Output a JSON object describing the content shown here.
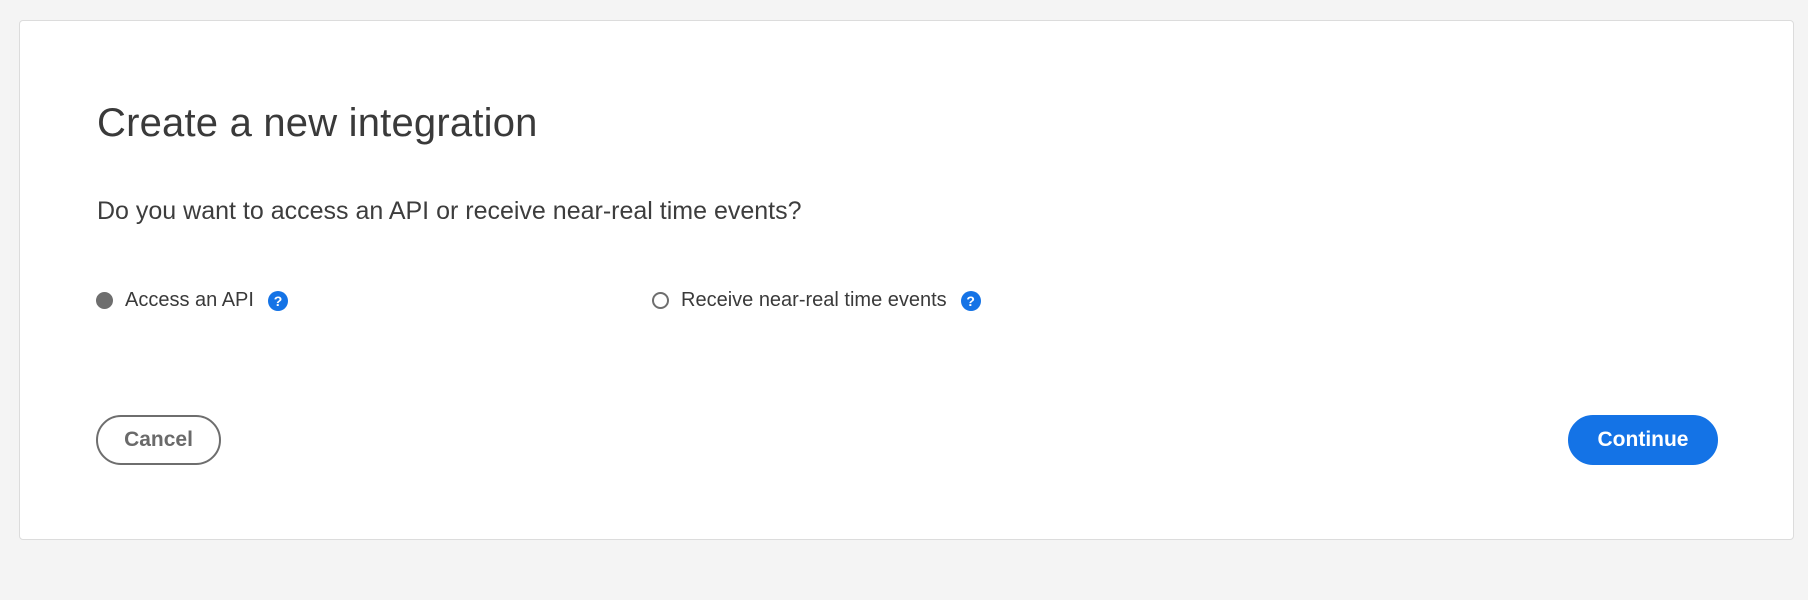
{
  "dialog": {
    "title": "Create a new integration",
    "question": "Do you want to access an API or receive near-real time events?",
    "options": [
      {
        "label": "Access an API",
        "selected": true,
        "help_icon": "?"
      },
      {
        "label": "Receive near-real time events",
        "selected": false,
        "help_icon": "?"
      }
    ],
    "cancel_label": "Cancel",
    "continue_label": "Continue"
  },
  "colors": {
    "accent": "#1473e6",
    "background": "#f4f4f4",
    "card": "#ffffff",
    "radio": "#6e6e6e"
  },
  "icons": {
    "help": "question-circle-icon",
    "radio_selected": "radio-checked-icon",
    "radio_unselected": "radio-unchecked-icon"
  }
}
